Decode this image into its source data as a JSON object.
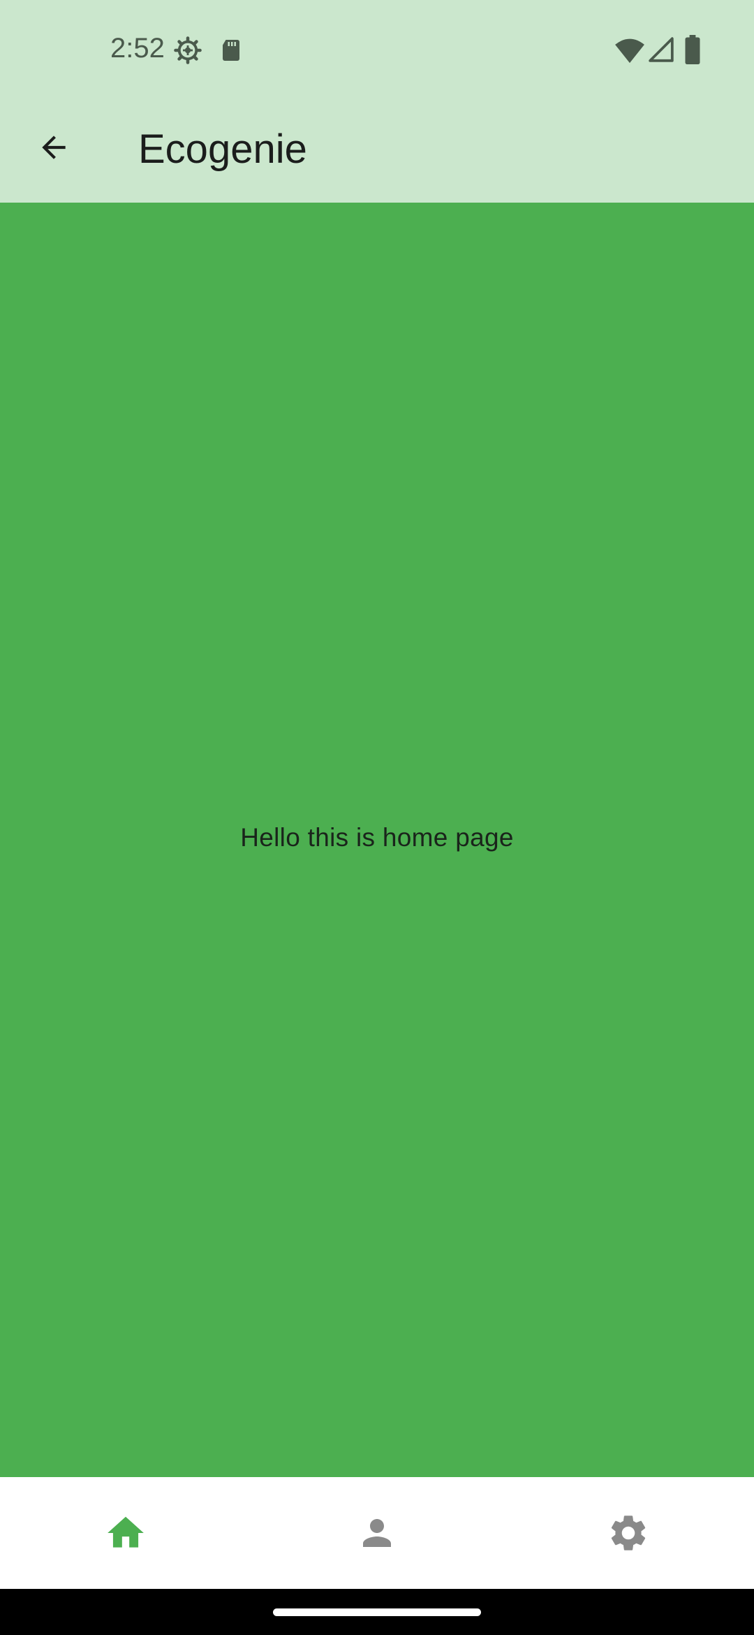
{
  "status_bar": {
    "time": "2:52",
    "icons": [
      "settings-gear-icon",
      "sd-card-icon",
      "wifi-icon",
      "cell-signal-icon",
      "battery-icon"
    ],
    "icon_color": "#4a5a4c"
  },
  "app_bar": {
    "title": "Ecogenie",
    "back_icon": "arrow-back-icon",
    "background": "#cbe7cd"
  },
  "main": {
    "message": "Hello this is home page",
    "background": "#4caf50"
  },
  "bottom_nav": {
    "items": [
      {
        "icon": "home-icon",
        "selected": true,
        "color": "#4caf50"
      },
      {
        "icon": "person-icon",
        "selected": false,
        "color": "#8a8a8a"
      },
      {
        "icon": "settings-icon",
        "selected": false,
        "color": "#8a8a8a"
      }
    ]
  }
}
